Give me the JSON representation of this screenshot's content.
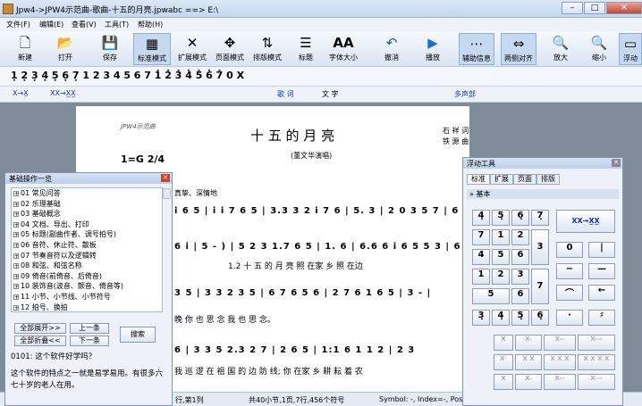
{
  "window": {
    "title": "Jpw4->JPW4示范曲-歌曲-十五的月亮.jpwabc ==> E:\\"
  },
  "menu": [
    "文件(F)",
    "编辑(E)",
    "查看(V)",
    "工具(T)",
    "帮助(H)"
  ],
  "toolbar": [
    "新建",
    "打开",
    "保存",
    "标准模式",
    "扩展模式",
    "页面模式",
    "排版模式",
    "标题",
    "字体大小",
    "撤消",
    "播放",
    "辅助信息",
    "两侧对齐",
    "放大",
    "缩小",
    "浮动"
  ],
  "notebar": "1̣ 2̣ 3̣ 4̣ 5̣ 6̣ 7̣ 1 2 3 4 5 6 7 1̇ 2̇ 3̇ 4̇ 5̇ 6̇ 7̇ 0 X",
  "symbar": {
    "xx_label": "X→X̱",
    "xx2_label": "XX→X̲X̲",
    "lyric": "歌 词",
    "text": "文 字",
    "multi": "多声部"
  },
  "score": {
    "watermark": "JPW4示范曲",
    "title": "十 五 的 月 亮",
    "subtitle": "(董文华演唱)",
    "key": "1=G 2/4",
    "credit1": "石     祥 词",
    "credit2": "铁 源 曲",
    "mood": "真挚、深情地",
    "line1": "i 6 5 | i i 7 6 5 | 3.3 3 2 i 7 6 | 5.   3 | 2 0 3 5 7 | 6 7 6",
    "line2": "6 i | 5 -  ) | 5 2 3 1.7 6 5 | 1.   6 | 6.6 6 i 6 5 5 3 | 6 5",
    "lyr2": "1.2 十 五 的 月        亮          照 在家 乡   照 在边",
    "line3": "3 5 | 3 3 2 3 5 | 6 7 6 5 6 | 2 7 6 1 6 5 | 3    -   |",
    "lyr3": "晚    你   也 思 念   我    也    思        念。",
    "line4": "6 | 3 3  5  2.3 2 7 | 2 6  5 | 1:1 6 1 1 2 | 2 3",
    "lyr4": "我   巡 逻  在 祖 国 的     边 防 线;  你 在家 乡   耕 耘 着  农"
  },
  "panel": {
    "title": "基础操作一览",
    "items": [
      "01 常见问答",
      "02 乐理基础",
      "03 基础概念",
      "04 文档、导出、打印",
      "05 标题(副曲作者、调号拍号)",
      "06 音符、休止符、散板",
      "07 节奏音符以及逻辑转",
      "08 和弦、和弦名称",
      "09 倚音(前倚音、后倚音)",
      "10 装饰音(波音、颤音、倚音等)",
      "11 小节、小节线、小节符号",
      "12 拍号、换拍"
    ],
    "expand": "全部展开>>",
    "collapse": "全部折叠<<",
    "prev": "上一条",
    "next": "下一条",
    "search": "搜索",
    "q": "0101: 这个软件好学吗？",
    "a": "这个软件的特点之一就是易学易用。有很多六七十岁的老人在用。"
  },
  "float": {
    "title": "浮动工具",
    "tabs": [
      "标准",
      "扩展",
      "页面",
      "排版"
    ],
    "section": "基本",
    "keys": [
      "4̣",
      "5̣",
      "6̣",
      "7̣",
      "7",
      "1",
      "2",
      "4",
      "5",
      "6",
      "1",
      "2",
      "3",
      "5",
      "6",
      "7",
      "4",
      "0",
      "−",
      "3"
    ],
    "xx": "XX→X̲X̲"
  },
  "status": {
    "pos": "行,第1列",
    "info": "共40小节,1页,7行,456个符号",
    "symbol": "Symbol: -, Index=-, Pos"
  }
}
